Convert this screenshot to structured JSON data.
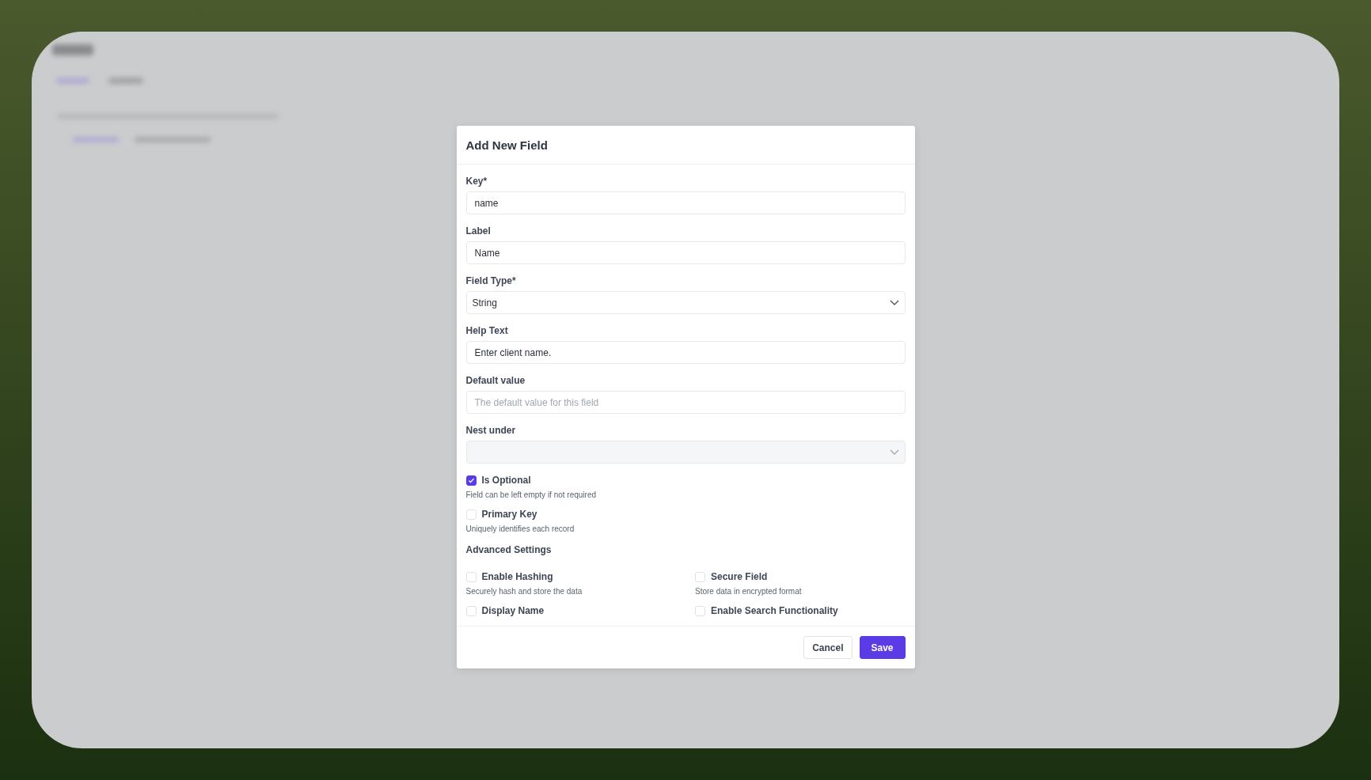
{
  "dialog": {
    "title": "Add New Field",
    "fields": [
      {
        "kind": "text",
        "label": "Key*",
        "value": "name"
      },
      {
        "kind": "text",
        "label": "Label",
        "value": "Name"
      },
      {
        "kind": "select",
        "label": "Field Type*",
        "value": "String"
      },
      {
        "kind": "text",
        "label": "Help Text",
        "value": "Enter client name."
      },
      {
        "kind": "text",
        "label": "Default value",
        "placeholder": "The default value for this field"
      },
      {
        "kind": "select",
        "label": "Nest under",
        "disabled": true
      }
    ],
    "options": [
      {
        "label": "Is Optional",
        "hint": "Field can be left empty if not required",
        "checked": true
      },
      {
        "label": "Primary Key",
        "hint": "Uniquely identifies each record",
        "checked": false
      }
    ],
    "advanced_settings": {
      "title": "Advanced Settings",
      "options": [
        {
          "label": "Enable Hashing",
          "hint": "Securely hash and store the data",
          "checked": false
        },
        {
          "label": "Secure Field",
          "hint": "Store data in encrypted format",
          "checked": false
        },
        {
          "label": "Display Name",
          "checked": false
        },
        {
          "label": "Enable Search Functionality",
          "checked": false
        }
      ]
    },
    "buttons": [
      {
        "label": "Cancel",
        "kind": "secondary"
      },
      {
        "label": "Save",
        "kind": "primary"
      }
    ]
  }
}
